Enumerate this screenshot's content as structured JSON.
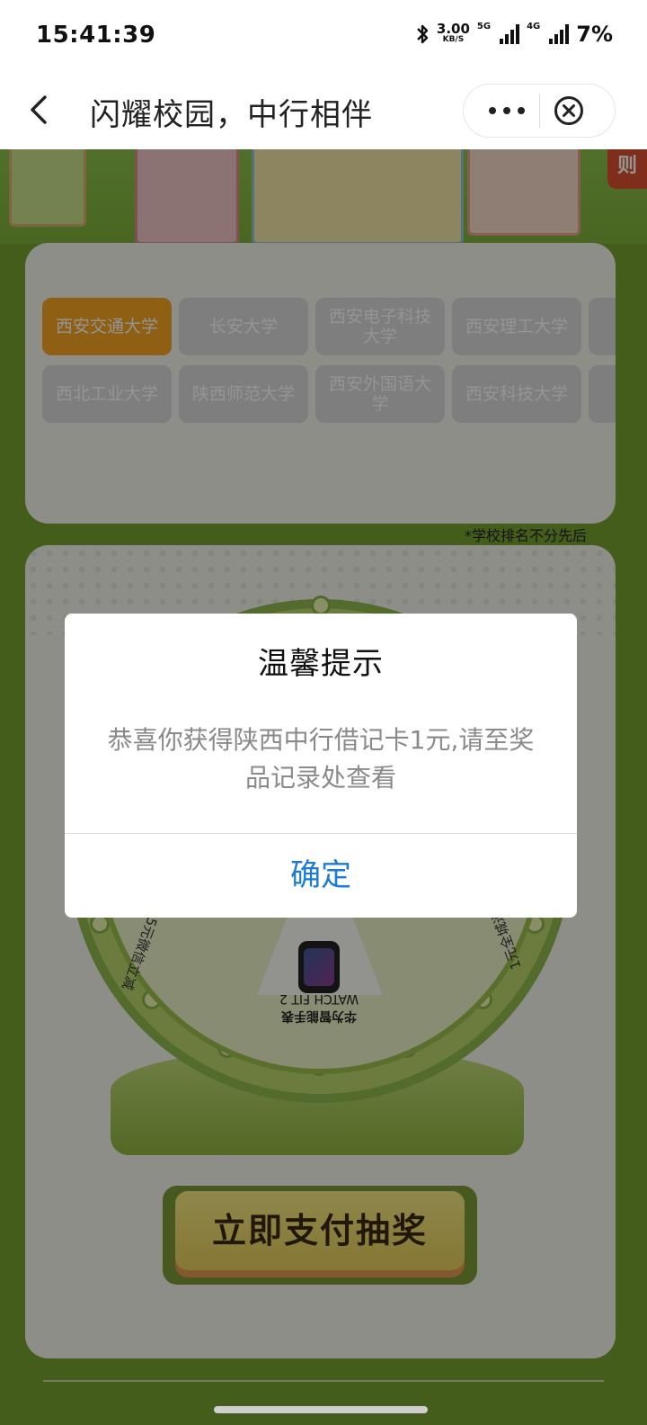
{
  "status_bar": {
    "time": "15:41:39",
    "net_speed_value": "3.00",
    "net_speed_unit": "KB/S",
    "sim1_label": "5G",
    "sim2_label": "4G",
    "battery": "7%"
  },
  "nav": {
    "title": "闪耀校园，中行相伴"
  },
  "hero": {
    "rule_tab": "则"
  },
  "schools": {
    "row1": [
      "西安交通大学",
      "长安大学",
      "西安电子科技大学",
      "西安理工大学"
    ],
    "row2": [
      "西北工业大学",
      "陕西师范大学",
      "西安外国语大学",
      "西安科技大学"
    ],
    "note": "*学校排名不分先后"
  },
  "wheel": {
    "prize_watch_title": "华为智能手表",
    "prize_watch_sub": "WATCH FIT 2",
    "prize_left": "5元微信立减",
    "prize_right": "1元全城通"
  },
  "draw_button": {
    "label": "立即支付抽奖"
  },
  "dialog": {
    "title": "温馨提示",
    "message": "恭喜你获得陕西中行借记卡1元,请至奖品记录处查看",
    "ok_label": "确定"
  }
}
